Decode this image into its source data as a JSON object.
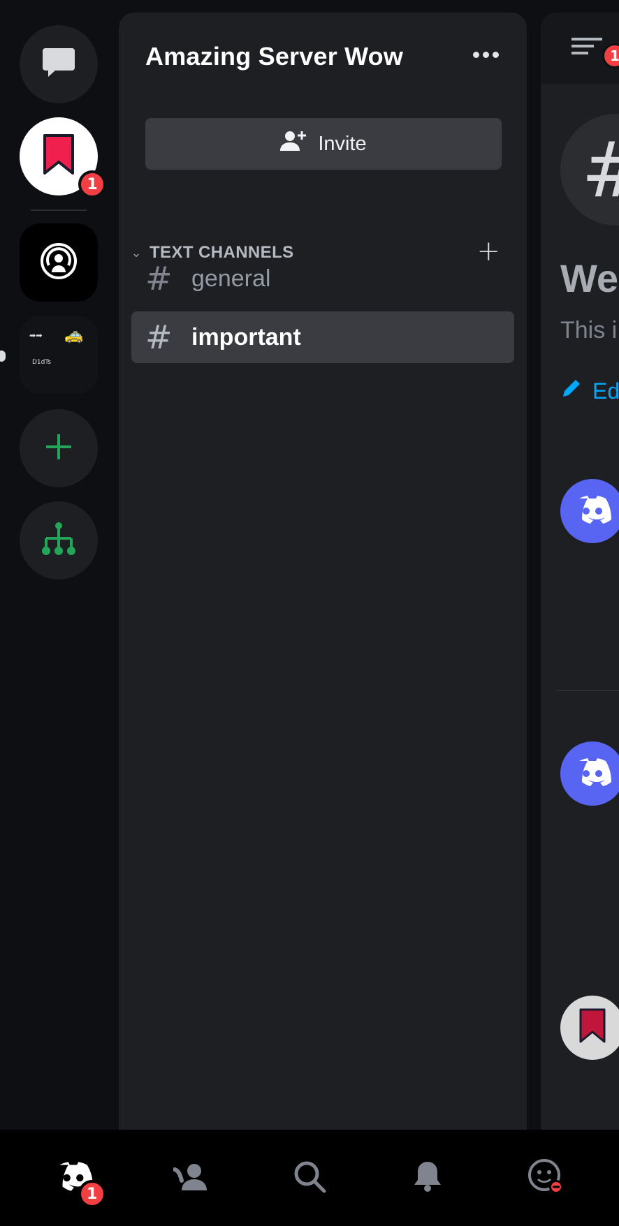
{
  "server": {
    "name": "Amazing Server Wow"
  },
  "invite": {
    "label": "Invite"
  },
  "category": {
    "label": "TEXT CHANNELS"
  },
  "channels": [
    {
      "name": "general",
      "active": false
    },
    {
      "name": "important",
      "active": true
    }
  ],
  "rail": {
    "bookmark_badge": "1",
    "folder_text": "D1dTs"
  },
  "peek": {
    "welcome": "We",
    "subtitle": "This i",
    "edit": "Ed",
    "header_badge": "1"
  },
  "bottom_nav": {
    "home_badge": "1",
    "items": [
      "home",
      "friends",
      "search",
      "notifications",
      "profile"
    ]
  },
  "colors": {
    "background": "#0e0f12",
    "panel": "#1e1f23",
    "selected": "#3a3c42",
    "badge": "#f23f43",
    "green": "#23a55a",
    "blurple": "#5865f2",
    "link": "#00a8fc"
  }
}
